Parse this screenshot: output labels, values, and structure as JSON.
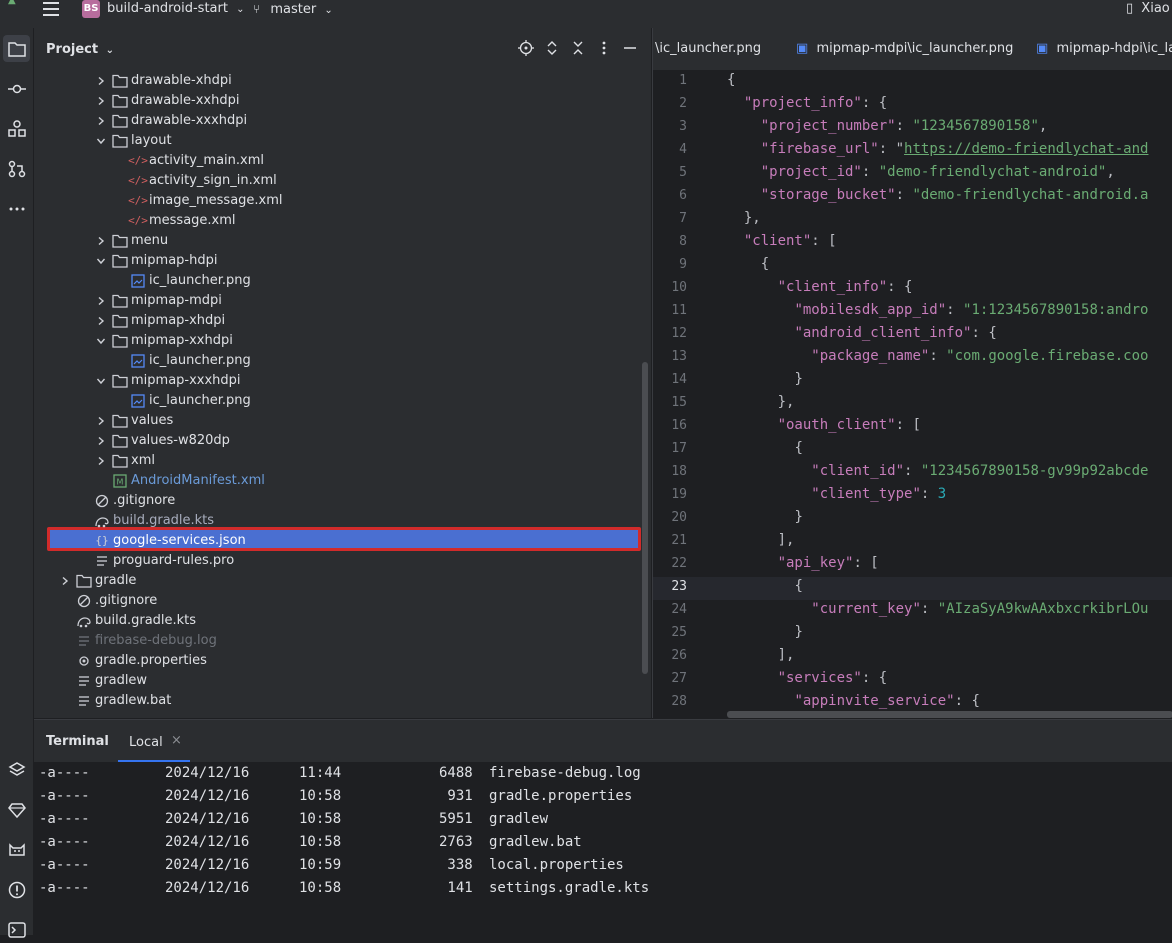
{
  "titlebar": {
    "project_badge": "BS",
    "project_name": "build-android-start",
    "branch": "master",
    "user": "Xiao"
  },
  "project_panel": {
    "title": "Project",
    "tree": [
      {
        "label": "drawable-xhdpi",
        "type": "folder",
        "expanded": false,
        "depth": 2
      },
      {
        "label": "drawable-xxhdpi",
        "type": "folder",
        "expanded": false,
        "depth": 2
      },
      {
        "label": "drawable-xxxhdpi",
        "type": "folder",
        "expanded": false,
        "depth": 2
      },
      {
        "label": "layout",
        "type": "folder",
        "expanded": true,
        "depth": 2
      },
      {
        "label": "activity_main.xml",
        "type": "xml",
        "depth": 3
      },
      {
        "label": "activity_sign_in.xml",
        "type": "xml",
        "depth": 3
      },
      {
        "label": "image_message.xml",
        "type": "xml",
        "depth": 3
      },
      {
        "label": "message.xml",
        "type": "xml",
        "depth": 3
      },
      {
        "label": "menu",
        "type": "folder",
        "expanded": false,
        "depth": 2
      },
      {
        "label": "mipmap-hdpi",
        "type": "folder",
        "expanded": true,
        "depth": 2
      },
      {
        "label": "ic_launcher.png",
        "type": "png",
        "depth": 3
      },
      {
        "label": "mipmap-mdpi",
        "type": "folder",
        "expanded": false,
        "depth": 2
      },
      {
        "label": "mipmap-xhdpi",
        "type": "folder",
        "expanded": false,
        "depth": 2
      },
      {
        "label": "mipmap-xxhdpi",
        "type": "folder",
        "expanded": true,
        "depth": 2
      },
      {
        "label": "ic_launcher.png",
        "type": "png",
        "depth": 3
      },
      {
        "label": "mipmap-xxxhdpi",
        "type": "folder",
        "expanded": true,
        "depth": 2
      },
      {
        "label": "ic_launcher.png",
        "type": "png",
        "depth": 3
      },
      {
        "label": "values",
        "type": "folder",
        "expanded": false,
        "depth": 2
      },
      {
        "label": "values-w820dp",
        "type": "folder",
        "expanded": false,
        "depth": 2
      },
      {
        "label": "xml",
        "type": "folder",
        "expanded": false,
        "depth": 2
      },
      {
        "label": "AndroidManifest.xml",
        "type": "manifest",
        "depth": 2
      },
      {
        "label": ".gitignore",
        "type": "ignore",
        "depth": 1
      },
      {
        "label": "build.gradle.kts",
        "type": "gradle",
        "depth": 1
      },
      {
        "label": "google-services.json",
        "type": "json",
        "depth": 1,
        "selected": true
      },
      {
        "label": "proguard-rules.pro",
        "type": "text",
        "depth": 1
      },
      {
        "label": "gradle",
        "type": "folder",
        "expanded": false,
        "depth": 0
      },
      {
        "label": ".gitignore",
        "type": "ignore",
        "depth": 0
      },
      {
        "label": "build.gradle.kts",
        "type": "gradle",
        "depth": 0
      },
      {
        "label": "firebase-debug.log",
        "type": "log",
        "depth": 0
      },
      {
        "label": "gradle.properties",
        "type": "props",
        "depth": 0
      },
      {
        "label": "gradlew",
        "type": "text",
        "depth": 0
      },
      {
        "label": "gradlew.bat",
        "type": "text",
        "depth": 0
      }
    ]
  },
  "editor": {
    "tabs": [
      "\\ic_launcher.png",
      "mipmap-mdpi\\ic_launcher.png",
      "mipmap-hdpi\\ic_lau"
    ],
    "line_numbers": [
      "1",
      "2",
      "3",
      "4",
      "5",
      "6",
      "7",
      "8",
      "9",
      "10",
      "11",
      "12",
      "13",
      "14",
      "15",
      "16",
      "17",
      "18",
      "19",
      "20",
      "21",
      "22",
      "23",
      "24",
      "25",
      "26",
      "27",
      "28"
    ],
    "current_line": "23",
    "code": [
      "{",
      "  \"project_info\": {",
      "    \"project_number\": \"1234567890158\",",
      "    \"firebase_url\": \"https://demo-friendlychat-and",
      "    \"project_id\": \"demo-friendlychat-android\",",
      "    \"storage_bucket\": \"demo-friendlychat-android.a",
      "  },",
      "  \"client\": [",
      "    {",
      "      \"client_info\": {",
      "        \"mobilesdk_app_id\": \"1:1234567890158:andro",
      "        \"android_client_info\": {",
      "          \"package_name\": \"com.google.firebase.coo",
      "        }",
      "      },",
      "      \"oauth_client\": [",
      "        {",
      "          \"client_id\": \"1234567890158-gv99p92abcde",
      "          \"client_type\": 3",
      "        }",
      "      ],",
      "      \"api_key\": [",
      "        {",
      "          \"current_key\": \"AIzaSyA9kwAAxbxcrkibrLOu",
      "        }",
      "      ],",
      "      \"services\": {",
      "        \"appinvite_service\": {"
    ]
  },
  "terminal": {
    "title": "Terminal",
    "tab_label": "Local",
    "tab_close": "×",
    "rows": [
      {
        "mode": "-a----",
        "date": "2024/12/16",
        "time": "11:44",
        "size": "6488",
        "name": "firebase-debug.log"
      },
      {
        "mode": "-a----",
        "date": "2024/12/16",
        "time": "10:58",
        "size": "931",
        "name": "gradle.properties"
      },
      {
        "mode": "-a----",
        "date": "2024/12/16",
        "time": "10:58",
        "size": "5951",
        "name": "gradlew"
      },
      {
        "mode": "-a----",
        "date": "2024/12/16",
        "time": "10:58",
        "size": "2763",
        "name": "gradlew.bat"
      },
      {
        "mode": "-a----",
        "date": "2024/12/16",
        "time": "10:59",
        "size": "338",
        "name": "local.properties"
      },
      {
        "mode": "-a----",
        "date": "2024/12/16",
        "time": "10:58",
        "size": "141",
        "name": "settings.gradle.kts"
      }
    ]
  }
}
